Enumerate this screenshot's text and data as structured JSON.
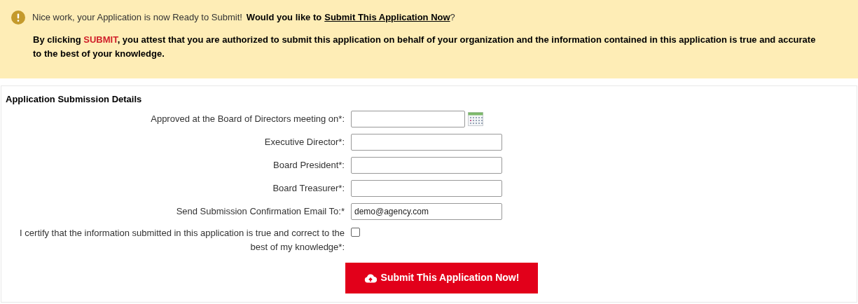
{
  "notice": {
    "message": "Nice work, your Application is now Ready to Submit!",
    "question": "Would you like to",
    "link": "Submit This Application Now",
    "question_end": "?",
    "attest_prefix": "By clicking ",
    "attest_highlight": "SUBMIT",
    "attest_rest": ", you attest that you are authorized to submit this application on behalf of your organization and the information contained in this application is true and accurate to the best of your knowledge."
  },
  "form": {
    "title": "Application Submission Details",
    "fields": [
      {
        "kind": "date",
        "label": "Approved at the Board of Directors meeting on*:"
      },
      {
        "kind": "text",
        "label": "Executive Director*:"
      },
      {
        "kind": "text",
        "label": "Board President*:"
      },
      {
        "kind": "text",
        "label": "Board Treasurer*:"
      },
      {
        "kind": "text",
        "label": "Send Submission Confirmation Email To:*",
        "value": "demo@agency.com"
      },
      {
        "kind": "checkbox",
        "label": "I certify that the information submitted in this application is true and correct to the best of my knowledge*:",
        "checked": false
      }
    ],
    "submit": "Submit This Application Now!"
  }
}
